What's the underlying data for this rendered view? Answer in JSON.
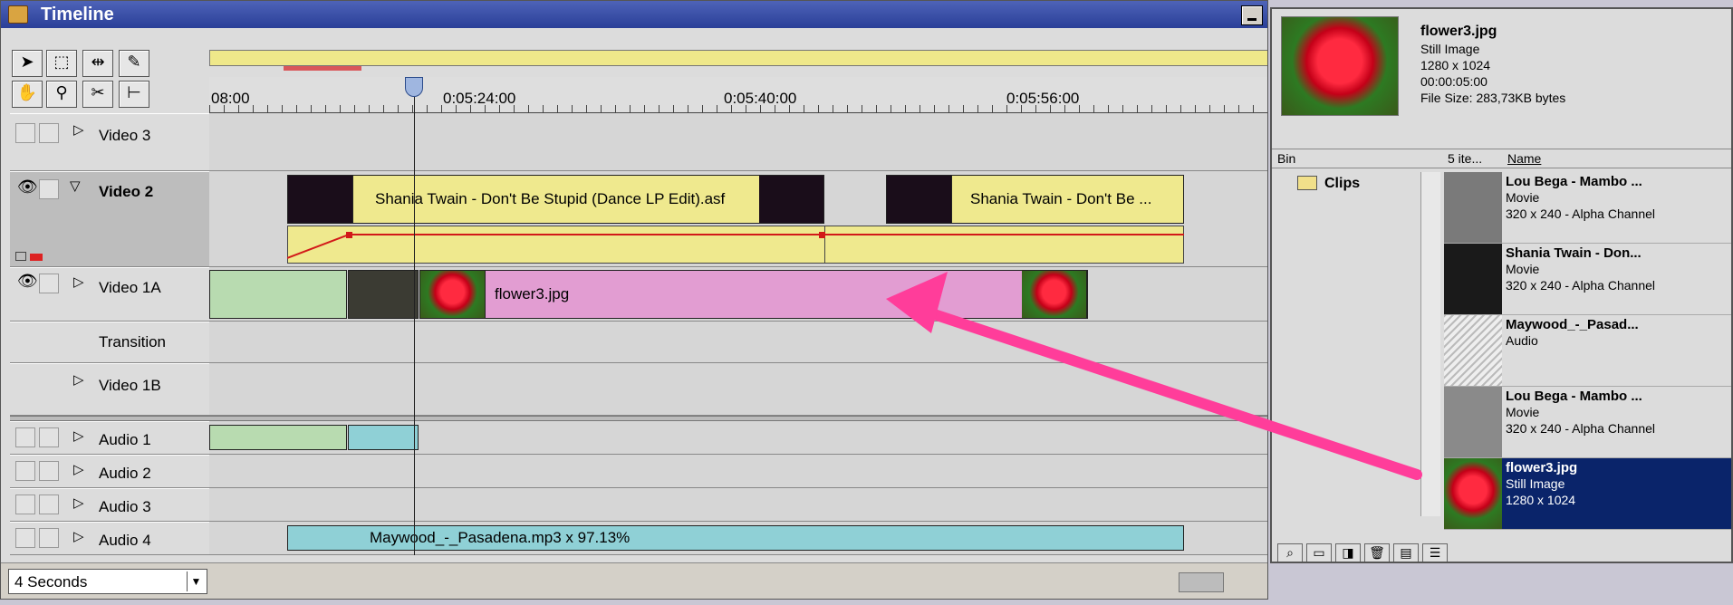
{
  "window": {
    "title": "Timeline"
  },
  "ruler": {
    "times": [
      "08:00",
      "0:05:24:00",
      "0:05:40:00",
      "0:05:56:00"
    ]
  },
  "tracks": [
    {
      "label": "Video 3"
    },
    {
      "label": "Video 2"
    },
    {
      "label": "Video 1A"
    },
    {
      "label": "Transition"
    },
    {
      "label": "Video 1B"
    },
    {
      "label": "Audio 1"
    },
    {
      "label": "Audio 2"
    },
    {
      "label": "Audio 3"
    },
    {
      "label": "Audio 4"
    }
  ],
  "clips": {
    "video2_a": "Shania Twain - Don't Be Stupid (Dance LP Edit).asf",
    "video2_b": "Shania Twain - Don't Be ...",
    "video1a": "flower3.jpg",
    "audio4": "Maywood_-_Pasadena.mp3 x 97.13%"
  },
  "bottombar": {
    "zoom": "4 Seconds"
  },
  "preview": {
    "name": "flower3.jpg",
    "type": "Still Image",
    "dims": "1280 x 1024",
    "duration": "00:00:05:00",
    "filesize": "File Size: 283,73KB bytes"
  },
  "bin": {
    "col_bin": "Bin",
    "col_items": "5 ite...",
    "col_name": "Name",
    "folder": "Clips",
    "items": [
      {
        "name": "Lou Bega - Mambo ...",
        "type": "Movie",
        "info": "320 x 240 - Alpha Channel"
      },
      {
        "name": "Shania Twain - Don...",
        "type": "Movie",
        "info": "320 x 240 - Alpha Channel"
      },
      {
        "name": "Maywood_-_Pasad...",
        "type": "Audio",
        "info": ""
      },
      {
        "name": "Lou Bega - Mambo ...",
        "type": "Movie",
        "info": "320 x 240 - Alpha Channel"
      },
      {
        "name": "flower3.jpg",
        "type": "Still Image",
        "info": "1280 x 1024"
      }
    ]
  },
  "colors": {
    "arrow": "#ff3d9a",
    "selection": "#0a246a",
    "title": "#2a3f98"
  }
}
